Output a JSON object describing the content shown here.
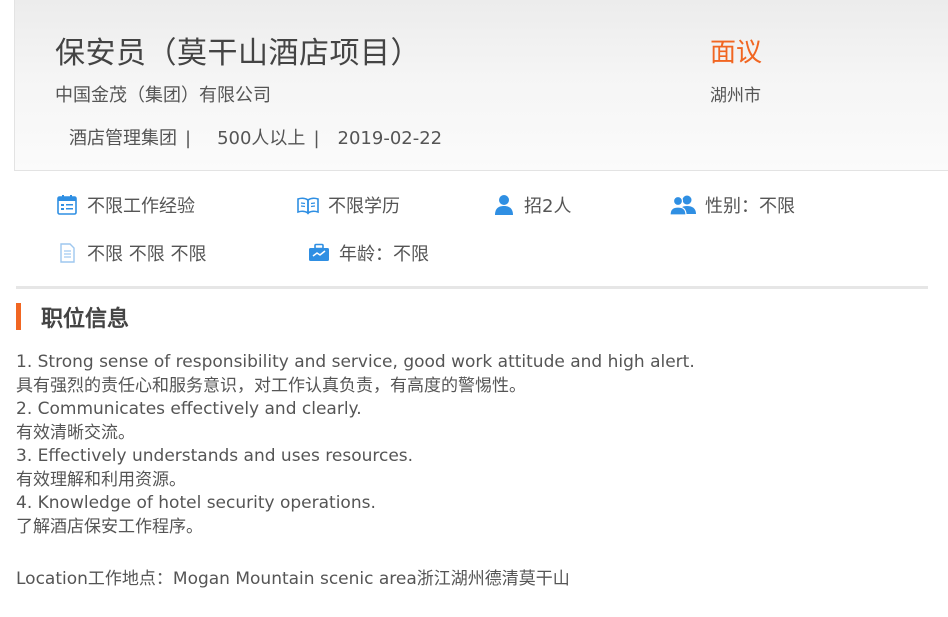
{
  "job": {
    "title": "保安员（莫干山酒店项目）",
    "company": "中国金茂（集团）有限公司",
    "industry": "酒店管理集团",
    "size": "500人以上",
    "date": "2019-02-22",
    "salary": "面议",
    "city": "湖州市",
    "separator": "|"
  },
  "requirements": {
    "experience": "不限工作经验",
    "education": "不限学历",
    "headcount": "招2人",
    "gender": "性别：不限",
    "other": "不限 不限 不限",
    "age": "年龄：不限"
  },
  "icons": {
    "experience": "calendar-icon",
    "education": "book-icon",
    "headcount": "person-icon",
    "gender": "people-icon",
    "other": "document-icon",
    "age": "briefcase-icon"
  },
  "section": {
    "title": "职位信息"
  },
  "description": {
    "lines": [
      "1. Strong sense of responsibility and service, good work attitude and high alert.",
      "具有强烈的责任心和服务意识，对工作认真负责，有高度的警惕性。",
      "2. Communicates effectively and clearly.",
      "有效清晰交流。",
      "3. Effectively understands and uses resources.",
      "有效理解和利用资源。",
      "4. Knowledge of hotel security operations.",
      "了解酒店保安工作程序。"
    ],
    "location": "Location工作地点：Mogan Mountain scenic area浙江湖州德清莫干山"
  },
  "colors": {
    "accent": "#f16622",
    "icon_blue": "#2f8fe3",
    "text": "#555555",
    "title": "#444444"
  }
}
